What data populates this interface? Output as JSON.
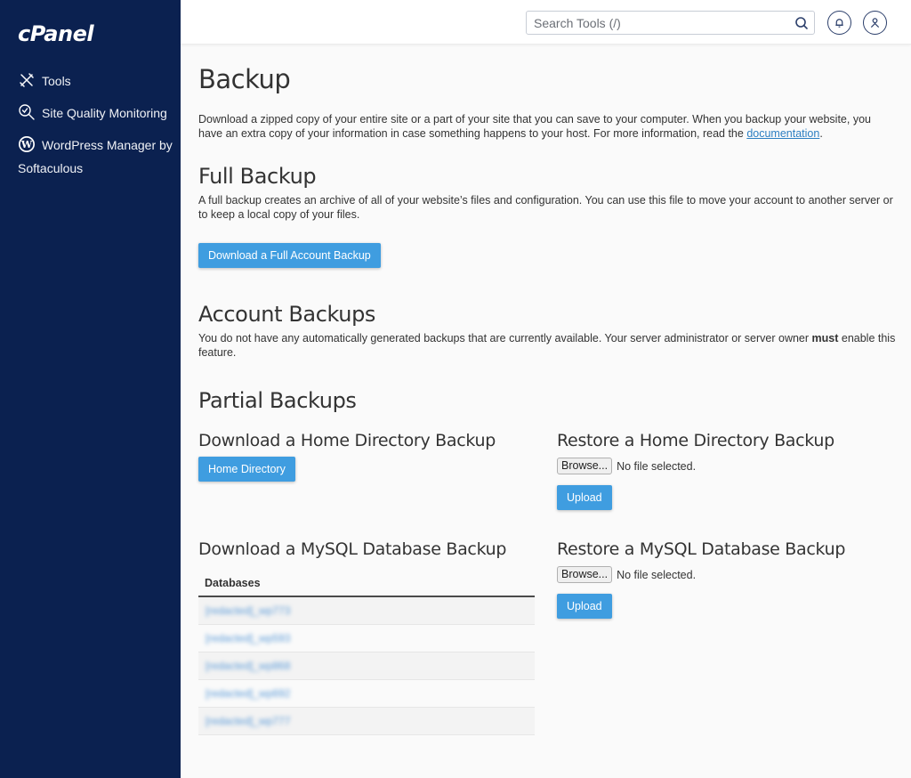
{
  "brand": {
    "logo_text": "cPanel",
    "sidebar_color": "#0b2150",
    "accent_color": "#3f9de0"
  },
  "sidebar": {
    "items": [
      {
        "label": "Tools",
        "icon": "tools-icon"
      },
      {
        "label": "Site Quality Monitoring",
        "icon": "site-quality-icon"
      },
      {
        "label": "WordPress Manager by Softaculous",
        "icon": "wordpress-icon"
      }
    ]
  },
  "topbar": {
    "search_placeholder": "Search Tools (/)",
    "icons": [
      "search-icon",
      "bell-icon",
      "user-icon"
    ]
  },
  "page": {
    "title": "Backup",
    "intro_text": "Download a zipped copy of your entire site or a part of your site that you can save to your computer. When you backup your website, you have an extra copy of your information in case something happens to your host. For more information, read the ",
    "intro_link": "documentation",
    "intro_end": ".",
    "full_backup": {
      "heading": "Full Backup",
      "text": "A full backup creates an archive of all of your website’s files and configuration. You can use this file to move your account to another server or to keep a local copy of your files.",
      "button": "Download a Full Account Backup"
    },
    "account_backups": {
      "heading": "Account Backups",
      "text_before": "You do not have any automatically generated backups that are currently available. Your server administrator or server owner ",
      "text_bold": "must",
      "text_after": " enable this feature."
    },
    "partial_backups": {
      "heading": "Partial Backups",
      "home_download": {
        "heading": "Download a Home Directory Backup",
        "button": "Home Directory"
      },
      "home_restore": {
        "heading": "Restore a Home Directory Backup",
        "browse": "Browse...",
        "file_status": "No file selected.",
        "upload": "Upload"
      },
      "mysql_download": {
        "heading": "Download a MySQL Database Backup",
        "column_header": "Databases",
        "rows": [
          "[redacted]_wp773",
          "[redacted]_wp593",
          "[redacted]_wp868",
          "[redacted]_wp692",
          "[redacted]_wp777"
        ]
      },
      "mysql_restore": {
        "heading": "Restore a MySQL Database Backup",
        "browse": "Browse...",
        "file_status": "No file selected.",
        "upload": "Upload"
      }
    }
  }
}
